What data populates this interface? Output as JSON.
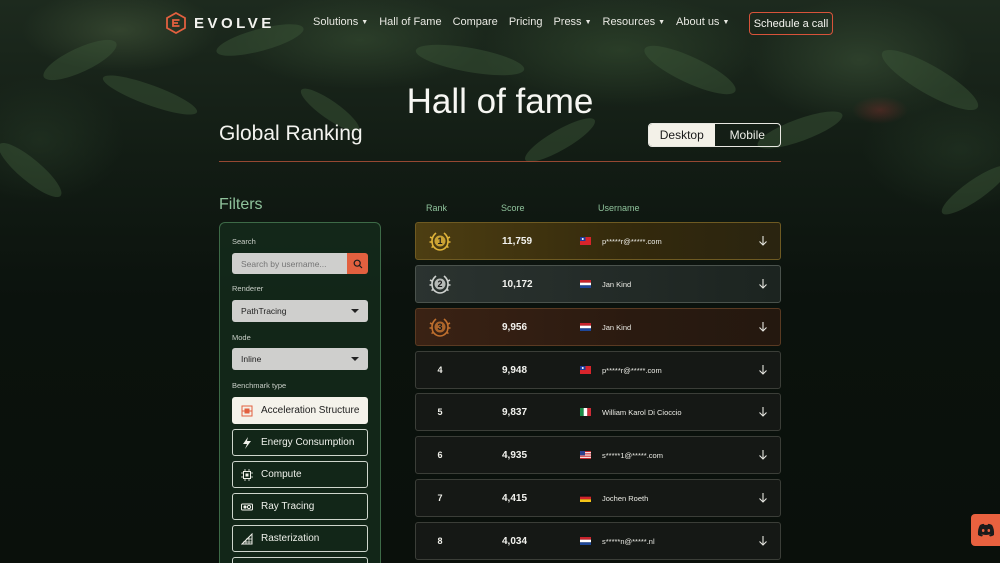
{
  "brand": {
    "name": "EVOLVE",
    "accent": "#e2603f"
  },
  "nav": {
    "items": [
      {
        "label": "Solutions",
        "dropdown": true
      },
      {
        "label": "Hall of Fame",
        "dropdown": false
      },
      {
        "label": "Compare",
        "dropdown": false
      },
      {
        "label": "Pricing",
        "dropdown": false
      },
      {
        "label": "Press",
        "dropdown": true
      },
      {
        "label": "Resources",
        "dropdown": true
      },
      {
        "label": "About us",
        "dropdown": true
      }
    ],
    "cta": "Schedule a call"
  },
  "hero": {
    "title": "Hall of fame"
  },
  "ranking": {
    "title": "Global Ranking",
    "platform_toggle": {
      "options": [
        "Desktop",
        "Mobile"
      ],
      "selected": "Desktop"
    }
  },
  "filters": {
    "title": "Filters",
    "search_label": "Search",
    "search_placeholder": "Search by username...",
    "renderer_label": "Renderer",
    "renderer_value": "PathTracing",
    "mode_label": "Mode",
    "mode_value": "Inline",
    "benchmark_label": "Benchmark type",
    "benchmarks": [
      {
        "label": "Acceleration Structure",
        "icon": "acceleration-structure-icon",
        "active": true
      },
      {
        "label": "Energy Consumption",
        "icon": "lightning-icon",
        "active": false
      },
      {
        "label": "Compute",
        "icon": "chip-icon",
        "active": false
      },
      {
        "label": "Ray Tracing",
        "icon": "ray-tracing-icon",
        "active": false
      },
      {
        "label": "Rasterization",
        "icon": "rasterization-icon",
        "active": false
      }
    ]
  },
  "table": {
    "headers": {
      "rank": "Rank",
      "score": "Score",
      "username": "Username"
    },
    "rows": [
      {
        "rank": "1",
        "score": "11,759",
        "flag": "taiwan",
        "username": "p*****r@*****.com",
        "medal": "gold"
      },
      {
        "rank": "2",
        "score": "10,172",
        "flag": "netherlands",
        "username": "Jan Kind",
        "medal": "silver"
      },
      {
        "rank": "3",
        "score": "9,956",
        "flag": "netherlands",
        "username": "Jan Kind",
        "medal": "bronze"
      },
      {
        "rank": "4",
        "score": "9,948",
        "flag": "taiwan",
        "username": "p*****r@*****.com",
        "medal": ""
      },
      {
        "rank": "5",
        "score": "9,837",
        "flag": "italy",
        "username": "William Karol Di Cioccio",
        "medal": ""
      },
      {
        "rank": "6",
        "score": "4,935",
        "flag": "usa",
        "username": "s*****1@*****.com",
        "medal": ""
      },
      {
        "rank": "7",
        "score": "4,415",
        "flag": "germany",
        "username": "Jochen Roeth",
        "medal": ""
      },
      {
        "rank": "8",
        "score": "4,034",
        "flag": "netherlands",
        "username": "s*****n@*****.nl",
        "medal": ""
      }
    ]
  },
  "colors": {
    "gold": "#e0b43a",
    "silver": "#cfd2cf",
    "bronze": "#c0702e",
    "filter_green": "#8fc29b"
  }
}
